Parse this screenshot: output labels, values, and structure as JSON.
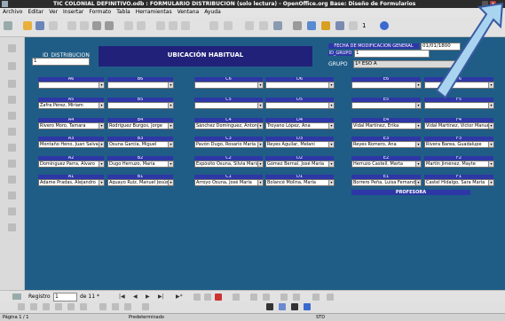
{
  "titlebar": {
    "title": "TIC COLONIAL DEFINITIVO.odb : FORMULARIO DISTRIBUCION (solo lectura) - OpenOffice.org Base: Diseño de Formularios",
    "close_label": "x"
  },
  "menu": [
    "Archivo",
    "Editar",
    "Ver",
    "Insertar",
    "Formato",
    "Tabla",
    "Herramientas",
    "Ventana",
    "Ayuda"
  ],
  "toolbar": {
    "zoom_value": "1"
  },
  "form": {
    "header": "UBICACIÓN HABITUAL",
    "id_label": "ID_DISTRIBUCION",
    "id_value": "1",
    "fecha_label": "FECHA DE MODIFICACIÓN GENERAL",
    "fecha_value": "01/01/1800",
    "idgrupo_label": "ID_GRUPO",
    "idgrupo_value": "1",
    "grupo_label": "GRUPO",
    "grupo_value": "1º ESO A",
    "profesora_label": "PROFESORA",
    "rows": [
      [
        {
          "label": "A6",
          "value": ""
        },
        {
          "label": "B6",
          "value": ""
        },
        {
          "label": "C6",
          "value": ""
        },
        {
          "label": "D6",
          "value": ""
        },
        {
          "label": "E6",
          "value": ""
        },
        {
          "label": "F6",
          "value": ""
        }
      ],
      [
        {
          "label": "A5",
          "value": "Zafra Pérez, Miriam"
        },
        {
          "label": "B5",
          "value": ""
        },
        {
          "label": "C5",
          "value": ""
        },
        {
          "label": "D5",
          "value": ""
        },
        {
          "label": "E5",
          "value": ""
        },
        {
          "label": "F5",
          "value": ""
        }
      ],
      [
        {
          "label": "A4",
          "value": "Rivero Moro, Tamara"
        },
        {
          "label": "B4",
          "value": "Rodríguez Burgos, Jorge"
        },
        {
          "label": "C4",
          "value": "Sánchez Domínguez, Antonio"
        },
        {
          "label": "D4",
          "value": "Troyano López, Ana"
        },
        {
          "label": "E4",
          "value": "Vidal Martínez, Erika"
        },
        {
          "label": "F4",
          "value": "Vidal Martínez, Víctor Manuel"
        }
      ],
      [
        {
          "label": "A3",
          "value": "Montaño Heno, Juan Salvador"
        },
        {
          "label": "B3",
          "value": "Osuna García, Miguel"
        },
        {
          "label": "C3",
          "value": "Pavón Dugo, Rosario María"
        },
        {
          "label": "D3",
          "value": "Reyes Aguilar, Melani"
        },
        {
          "label": "E3",
          "value": "Reyes Romero, Ana"
        },
        {
          "label": "F3",
          "value": "Rivera Barea, Guadalupe"
        }
      ],
      [
        {
          "label": "A2",
          "value": "Domínguez Parra, Álvaro"
        },
        {
          "label": "B2",
          "value": "Dugo Herruzo, María"
        },
        {
          "label": "C2",
          "value": "Expósito Osuna, Silvia María"
        },
        {
          "label": "D2",
          "value": "Gómez Bernal, José María"
        },
        {
          "label": "E2",
          "value": "Herruzo Castell, Marta"
        },
        {
          "label": "F2",
          "value": "Martín Jiménez, Mayte"
        }
      ],
      [
        {
          "label": "A1",
          "value": "Adame Pradas, Alejandro"
        },
        {
          "label": "B1",
          "value": "Aquayo Ruiz, Manuel Jesús"
        },
        {
          "label": "C1",
          "value": "Arroyo Osuna, José María"
        },
        {
          "label": "D1",
          "value": "Bolancé Molina, María"
        },
        {
          "label": "E1",
          "value": "Borrero Peña, Luisa Fernanda"
        },
        {
          "label": "F1",
          "value": "Castel Hidalgo, Sara María"
        }
      ]
    ]
  },
  "navigation": {
    "record_label": "Registro",
    "record_value": "1",
    "of_label": "de 11 *"
  },
  "status": {
    "page": "Página 1 / 1",
    "style": "Predeterminado",
    "mode": "STD"
  },
  "colors": {
    "form_bg": "#1f5d86",
    "label_bg": "#2e37a6",
    "header_bg": "#21217a"
  }
}
